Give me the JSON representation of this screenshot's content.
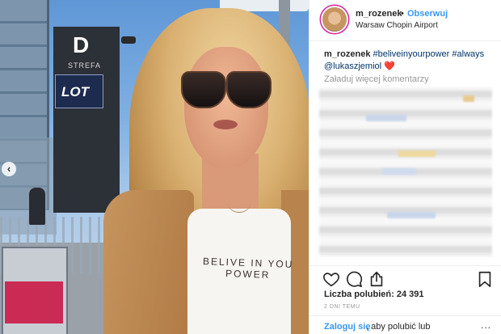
{
  "photo": {
    "sign_letter": "D",
    "sign_zone": "STREFA",
    "sign_airline": "LOT",
    "shirt_line1": "BELIVE IN YOU",
    "shirt_line2": "POWER",
    "prev_glyph": "‹"
  },
  "header": {
    "username": "m_rozenek",
    "separator": "•",
    "follow_label": "Obserwuj",
    "location": "Warsaw Chopin Airport"
  },
  "caption": {
    "username": "m_rozenek",
    "tag1": "#beliveinyourpower",
    "tag2": "#always",
    "mention": "@lukaszjemiol",
    "heart": "❤️"
  },
  "comments": {
    "load_more": "Załaduj więcej komentarzy"
  },
  "actions": {
    "likes": "Liczba polubień: 24 391",
    "date": "2 DNI TEMU",
    "icons": [
      "heart-icon",
      "comment-icon",
      "share-icon",
      "bookmark-icon"
    ]
  },
  "login": {
    "link": "Zaloguj się",
    "rest": ", aby polubić lub",
    "more": "..."
  },
  "colors": {
    "link": "#3897f0",
    "text": "#262626",
    "muted": "#999999",
    "heart": "#ed4956"
  }
}
